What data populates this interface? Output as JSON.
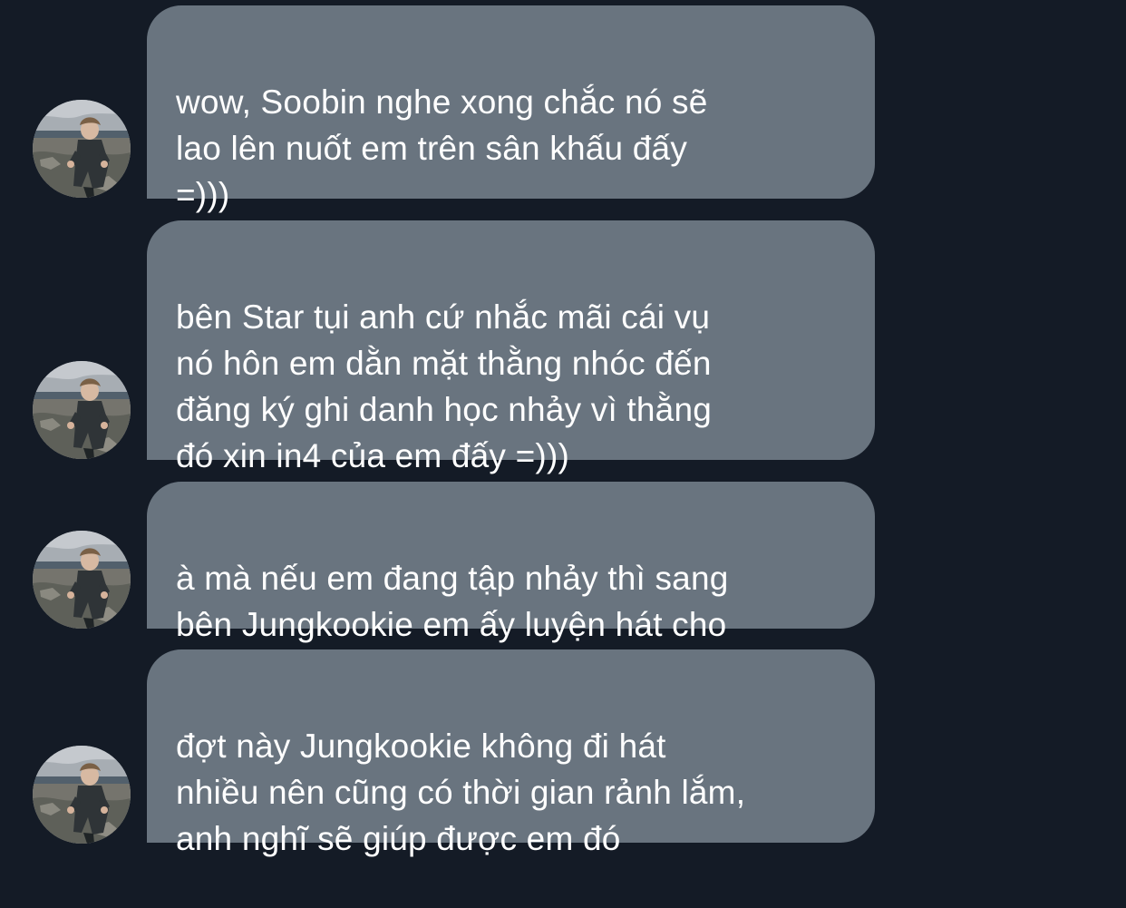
{
  "conversation": {
    "messages": [
      {
        "text": "wow, Soobin nghe xong chắc nó sẽ\nlao lên nuốt em trên sân khấu đấy\n=)))",
        "avatar_icon": "profile-photo"
      },
      {
        "text": "bên Star tụi anh cứ nhắc mãi cái vụ\nnó hôn em dằn mặt thằng nhóc đến\nđăng ký ghi danh học nhảy vì thằng\nđó xin in4 của em đấy =)))",
        "avatar_icon": "profile-photo"
      },
      {
        "text": "à mà nếu em đang tập nhảy thì sang\nbên Jungkookie em ấy luyện hát cho",
        "avatar_icon": "profile-photo"
      },
      {
        "text": "đợt này Jungkookie không đi hát\nnhiều nên cũng có thời gian rảnh lắm,\nanh nghĩ sẽ giúp được em đó",
        "avatar_icon": "profile-photo"
      }
    ]
  },
  "colors": {
    "background": "#141b26",
    "bubble": "#69747f",
    "text": "#ffffff"
  }
}
